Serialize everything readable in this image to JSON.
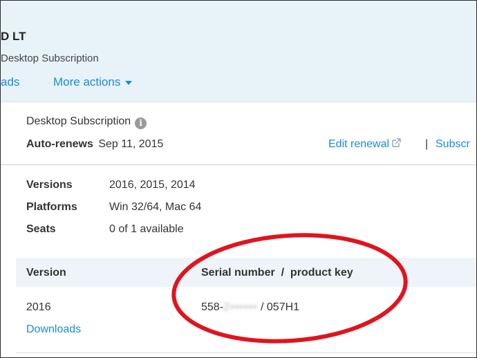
{
  "header": {
    "product_title": "D LT",
    "product_subtitle": "Desktop Subscription",
    "downloads_link": "ads",
    "more_actions": "More actions"
  },
  "subscription": {
    "type": "Desktop Subscription",
    "auto_renews_label": "Auto-renews",
    "auto_renews_date": "Sep 11, 2015",
    "edit_renewal": "Edit renewal",
    "separator": "|",
    "subscr_link": "Subscr"
  },
  "specs": [
    {
      "label": "Versions",
      "value": "2016, 2015, 2014"
    },
    {
      "label": "Platforms",
      "value": "Win 32/64, Mac 64"
    },
    {
      "label": "Seats",
      "value": "0 of 1 available"
    }
  ],
  "table": {
    "headers": {
      "version": "Version",
      "serial": "Serial number  /  product key"
    },
    "rows": [
      {
        "version": "2016",
        "downloads": "Downloads",
        "serial_prefix": "558-",
        "serial_hidden": "2••••••",
        "separator": " / ",
        "product_key": "057H1"
      }
    ]
  },
  "colors": {
    "link": "#1a8ad4",
    "header_bg": "#e8f2f9",
    "annotation_ring": "#e0141e"
  },
  "icons": [
    "info-icon",
    "external-link-icon",
    "chevron-down-icon"
  ]
}
